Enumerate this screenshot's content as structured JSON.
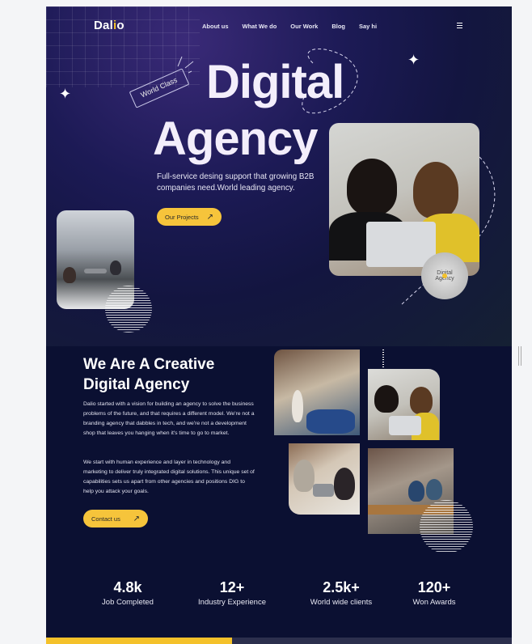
{
  "nav": {
    "logo_main": "Dal",
    "logo_dot": "i",
    "logo_end": "o",
    "links": [
      "About us",
      "What We do",
      "Our Work",
      "Blog",
      "Say hi"
    ]
  },
  "hero": {
    "badge": "World Class",
    "title_line1": "Digital",
    "title_line2": "Agency",
    "description": "Full-service desing support that growing B2B companies need.World leading agency.",
    "cta_label": "Our Projects",
    "circle_badge": "Digital Agency"
  },
  "about": {
    "title": "We Are A Creative Digital Agency",
    "paragraph1": "Dalio started with a vision for building an agency to solve the business problems of the future, and that requires a different model. We're not a branding agency that dabbles in tech, and we're not a development shop that leaves you hanging when it's time to go to market.",
    "paragraph2": "We start with human experience and layer in technology and marketing to deliver truly integrated digital solutions. This unique set of capabilities sets us apart from other agencies and positions DIG to help you attack your goals.",
    "cta_label": "Contact us"
  },
  "stats": [
    {
      "num": "4.8k",
      "label": "Job Completed"
    },
    {
      "num": "12+",
      "label": "Industry Experience"
    },
    {
      "num": "2.5k+",
      "label": "World wide clients"
    },
    {
      "num": "120+",
      "label": "Won Awards"
    }
  ],
  "colors": {
    "accent": "#f6c43b",
    "background": "#0d1130"
  }
}
